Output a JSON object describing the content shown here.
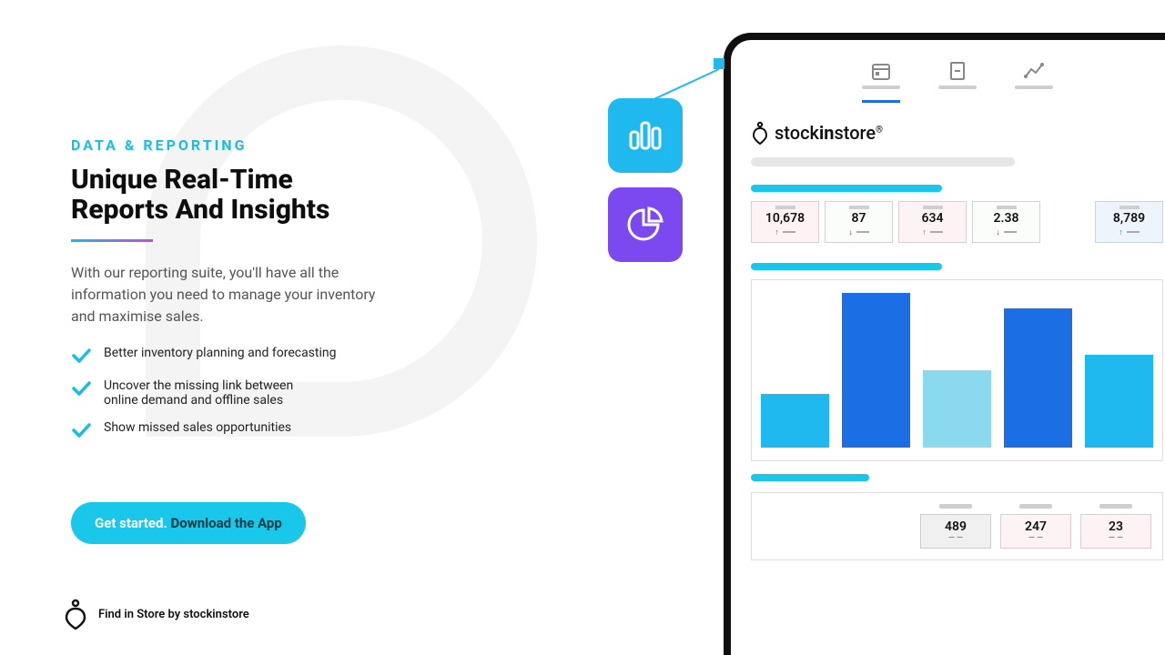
{
  "eyebrow": "DATA & REPORTING",
  "headline_l1": "Unique Real-Time",
  "headline_l2": "Reports And Insights",
  "copy": "With our reporting suite, you'll have all the information you need to manage your inventory and maximise sales.",
  "features": [
    "Better inventory planning and forecasting",
    "Uncover the missing link between online demand and offline sales",
    "Show missed sales opportunities"
  ],
  "cta_a": "Get started. ",
  "cta_b": "Download the App",
  "footer": "Find in Store by stockinstore",
  "brand_a": "stock",
  "brand_b": "in",
  "brand_c": "store",
  "metrics": [
    {
      "value": "10,678",
      "dir": "up",
      "style": "pink"
    },
    {
      "value": "87",
      "dir": "down",
      "style": "green"
    },
    {
      "value": "634",
      "dir": "up",
      "style": "pink"
    },
    {
      "value": "2.38",
      "dir": "down",
      "style": "green"
    },
    {
      "value": "8,789",
      "dir": "up",
      "style": "blue"
    }
  ],
  "chart_data": {
    "type": "bar",
    "values": [
      35,
      100,
      50,
      90,
      60
    ],
    "colors": [
      "blue",
      "dark",
      "light",
      "dark",
      "blue"
    ]
  },
  "bottom": [
    {
      "value": "489",
      "style": "gray"
    },
    {
      "value": "247",
      "style": "pink"
    },
    {
      "value": "23",
      "style": "pink"
    }
  ]
}
